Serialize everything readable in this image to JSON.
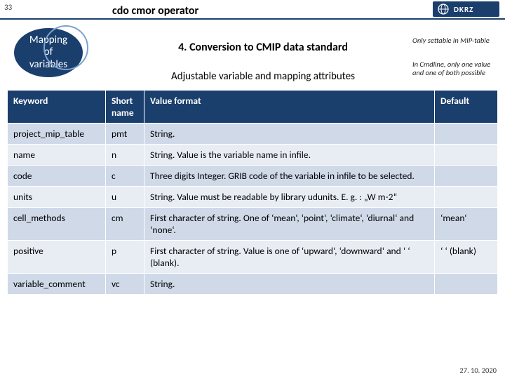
{
  "page_number": "33",
  "top_title": "cdo cmor operator",
  "logo_text": "DKRZ",
  "badge": {
    "line1": "Mapping",
    "line2": "of",
    "line3": "variables"
  },
  "heading": "4. Conversion to CMIP data standard",
  "subheading": "Adjustable variable and mapping attributes",
  "notes": {
    "n1": "Only settable in MIP-table",
    "n2": "In Cmdline, only one value and one of both possible"
  },
  "table": {
    "headers": {
      "keyword": "Keyword",
      "short": "Short name",
      "value": "Value format",
      "default": "Default"
    },
    "rows": [
      {
        "keyword": "project_mip_table",
        "short": "pmt",
        "value": "String.",
        "default": ""
      },
      {
        "keyword": "name",
        "short": "n",
        "value": "String. Value is the variable name in infile.",
        "default": ""
      },
      {
        "keyword": "code",
        "short": "c",
        "value": "Three digits Integer. GRIB code of the variable in infile to be selected.",
        "default": ""
      },
      {
        "keyword": "units",
        "short": "u",
        "value": "String. Value must be readable by library udunits. E. g. : „W m-2“",
        "default": ""
      },
      {
        "keyword": "cell_methods",
        "short": "cm",
        "value": "First character of string. One of ‘mean‘, ‘point‘, ‘climate‘, ‘diurnal‘ and ‘none‘.",
        "default": "‘mean‘"
      },
      {
        "keyword": "positive",
        "short": "p",
        "value": "First character of string. Value is one of ‘upward‘, ‘downward‘ and ‘ ‘ (blank).",
        "default": "‘ ‘ (blank)"
      },
      {
        "keyword": "variable_comment",
        "short": "vc",
        "value": "String.",
        "default": ""
      }
    ]
  },
  "footer_date": "27. 10. 2020"
}
